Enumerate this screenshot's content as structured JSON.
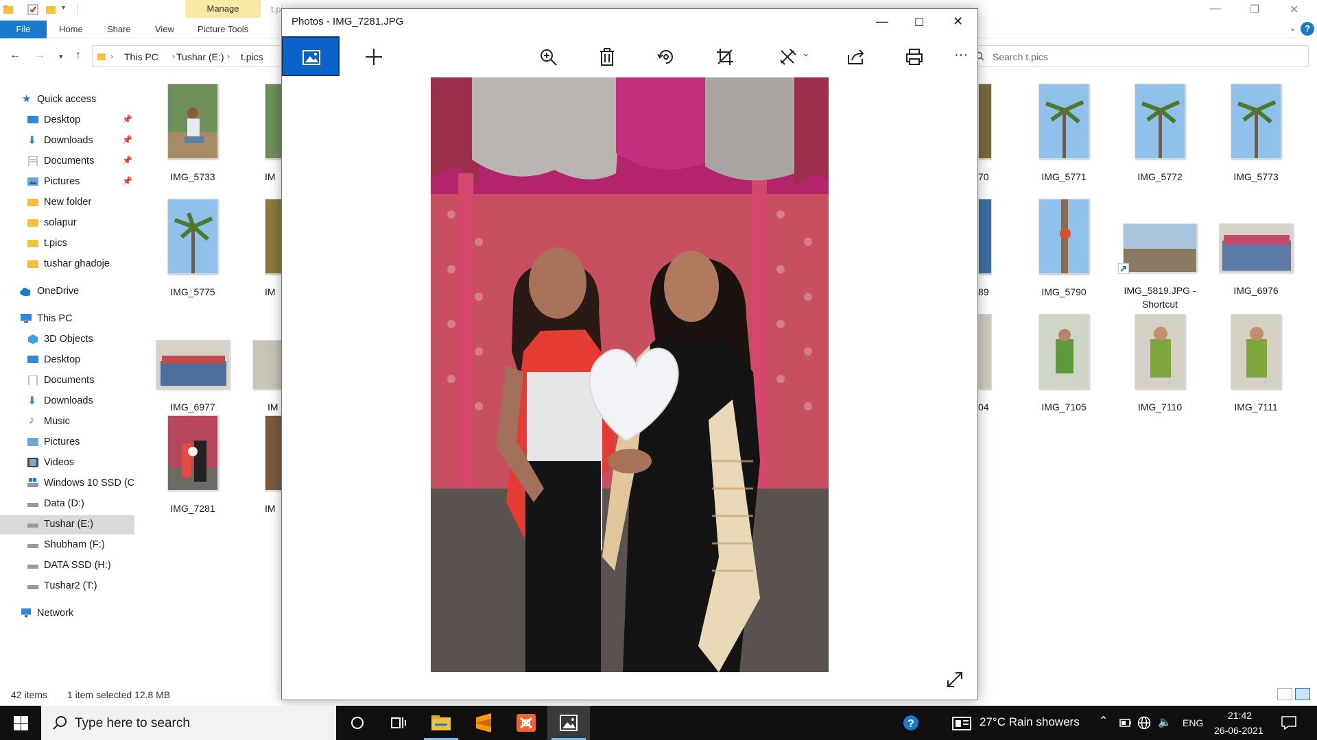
{
  "explorer": {
    "context_tab": "Manage",
    "window_title_partial": "t.pi",
    "ribbon_tabs": [
      "File",
      "Home",
      "Share",
      "View",
      "Picture Tools"
    ],
    "breadcrumb": [
      "This PC",
      "Tushar (E:)",
      "t.pics"
    ],
    "search_placeholder": "Search t.pics",
    "nav": {
      "quick_access": "Quick access",
      "quick_items": [
        "Desktop",
        "Downloads",
        "Documents",
        "Pictures",
        "New folder",
        "solapur",
        "t.pics",
        "tushar ghadoje"
      ],
      "onedrive": "OneDrive",
      "this_pc": "This PC",
      "pc_items": [
        "3D Objects",
        "Desktop",
        "Documents",
        "Downloads",
        "Music",
        "Pictures",
        "Videos",
        "Windows 10 SSD (C",
        "Data (D:)",
        "Tushar (E:)",
        "Shubham (F:)",
        "DATA SSD (H:)",
        "Tushar2 (T:)"
      ],
      "network": "Network"
    },
    "files_left": [
      [
        "IMG_5733",
        "IM"
      ],
      [
        "IMG_5775",
        "IM"
      ],
      [
        "IMG_6977",
        "IM"
      ],
      [
        "IMG_7281",
        "IM"
      ]
    ],
    "files_right": [
      [
        "70",
        "IMG_5771",
        "IMG_5772",
        "IMG_5773"
      ],
      [
        "89",
        "IMG_5790",
        "IMG_5819.JPG - Shortcut",
        "IMG_6976"
      ],
      [
        "04",
        "IMG_7105",
        "IMG_7110",
        "IMG_7111"
      ]
    ],
    "status": {
      "count": "42 items",
      "selection": "1 item selected  12.8 MB"
    }
  },
  "photos": {
    "title": "Photos - IMG_7281.JPG",
    "toolbar": [
      "see-all-photos",
      "add-to",
      "zoom",
      "delete",
      "rotate",
      "crop",
      "edit-and-create",
      "share",
      "print",
      "see-more"
    ],
    "see_more_label": "···"
  },
  "taskbar": {
    "search_placeholder": "Type here to search",
    "weather": "27°C  Rain showers",
    "language": "ENG",
    "time": "21:42",
    "date": "26-06-2021"
  },
  "colors": {
    "accent": "#0a63c9",
    "file_tab": "#1979ca",
    "context_tab": "#f7e9a6",
    "taskbar": "#101010"
  }
}
